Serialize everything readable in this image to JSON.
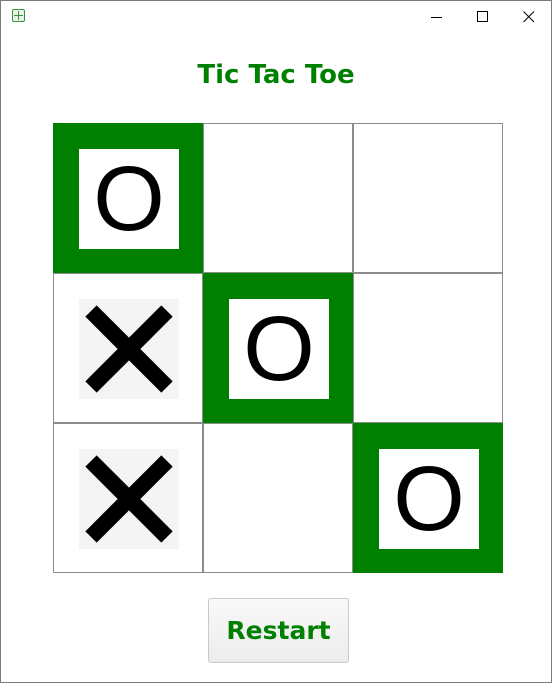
{
  "window": {
    "app_icon": "app-grid-icon",
    "controls": [
      {
        "name": "minimize",
        "icon": "minimize-icon"
      },
      {
        "name": "maximize",
        "icon": "maximize-icon"
      },
      {
        "name": "close",
        "icon": "close-icon"
      }
    ]
  },
  "game": {
    "title": "Tic Tac Toe",
    "board": [
      [
        "O",
        "",
        ""
      ],
      [
        "X",
        "O",
        ""
      ],
      [
        "X",
        "",
        "O"
      ]
    ],
    "winning_cells": [
      [
        0,
        0
      ],
      [
        1,
        1
      ],
      [
        2,
        2
      ]
    ],
    "restart_label": "Restart"
  },
  "colors": {
    "accent": "#008000",
    "mark": "#000000",
    "cell_border": "#8c8c8c",
    "tile_background": "#f4f4f4"
  }
}
